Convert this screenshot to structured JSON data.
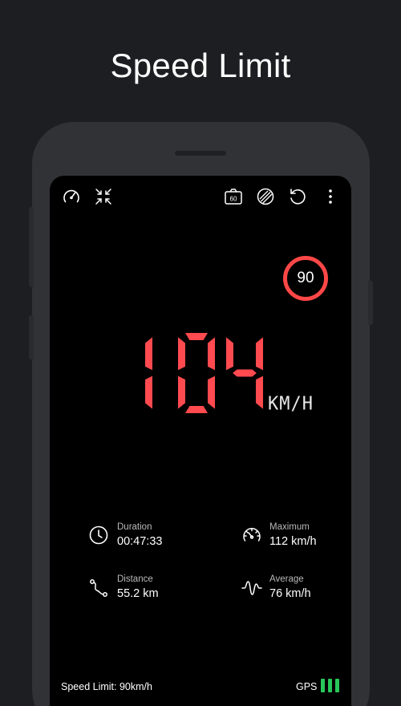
{
  "headline": "Speed Limit",
  "toolbar": {
    "icons": [
      "speedometer-icon",
      "minimize-icon",
      "speed-camera-icon",
      "theme-icon",
      "reset-icon",
      "more-icon"
    ]
  },
  "speed_limit_badge": "90",
  "speed": {
    "value": "104",
    "unit": "KM/H"
  },
  "stats": {
    "duration": {
      "label": "Duration",
      "value": "00:47:33"
    },
    "maximum": {
      "label": "Maximum",
      "value": "112 km/h"
    },
    "distance": {
      "label": "Distance",
      "value": "55.2 km"
    },
    "average": {
      "label": "Average",
      "value": "76 km/h"
    }
  },
  "footer": {
    "speed_limit_text": "Speed Limit: 90km/h",
    "gps_label": "GPS",
    "gps_signal_bars": 3
  },
  "colors": {
    "background": "#1d1e21",
    "digit_red": "#ff4a4f",
    "limit_ring": "#ff4747",
    "gps_green": "#28c75a"
  }
}
